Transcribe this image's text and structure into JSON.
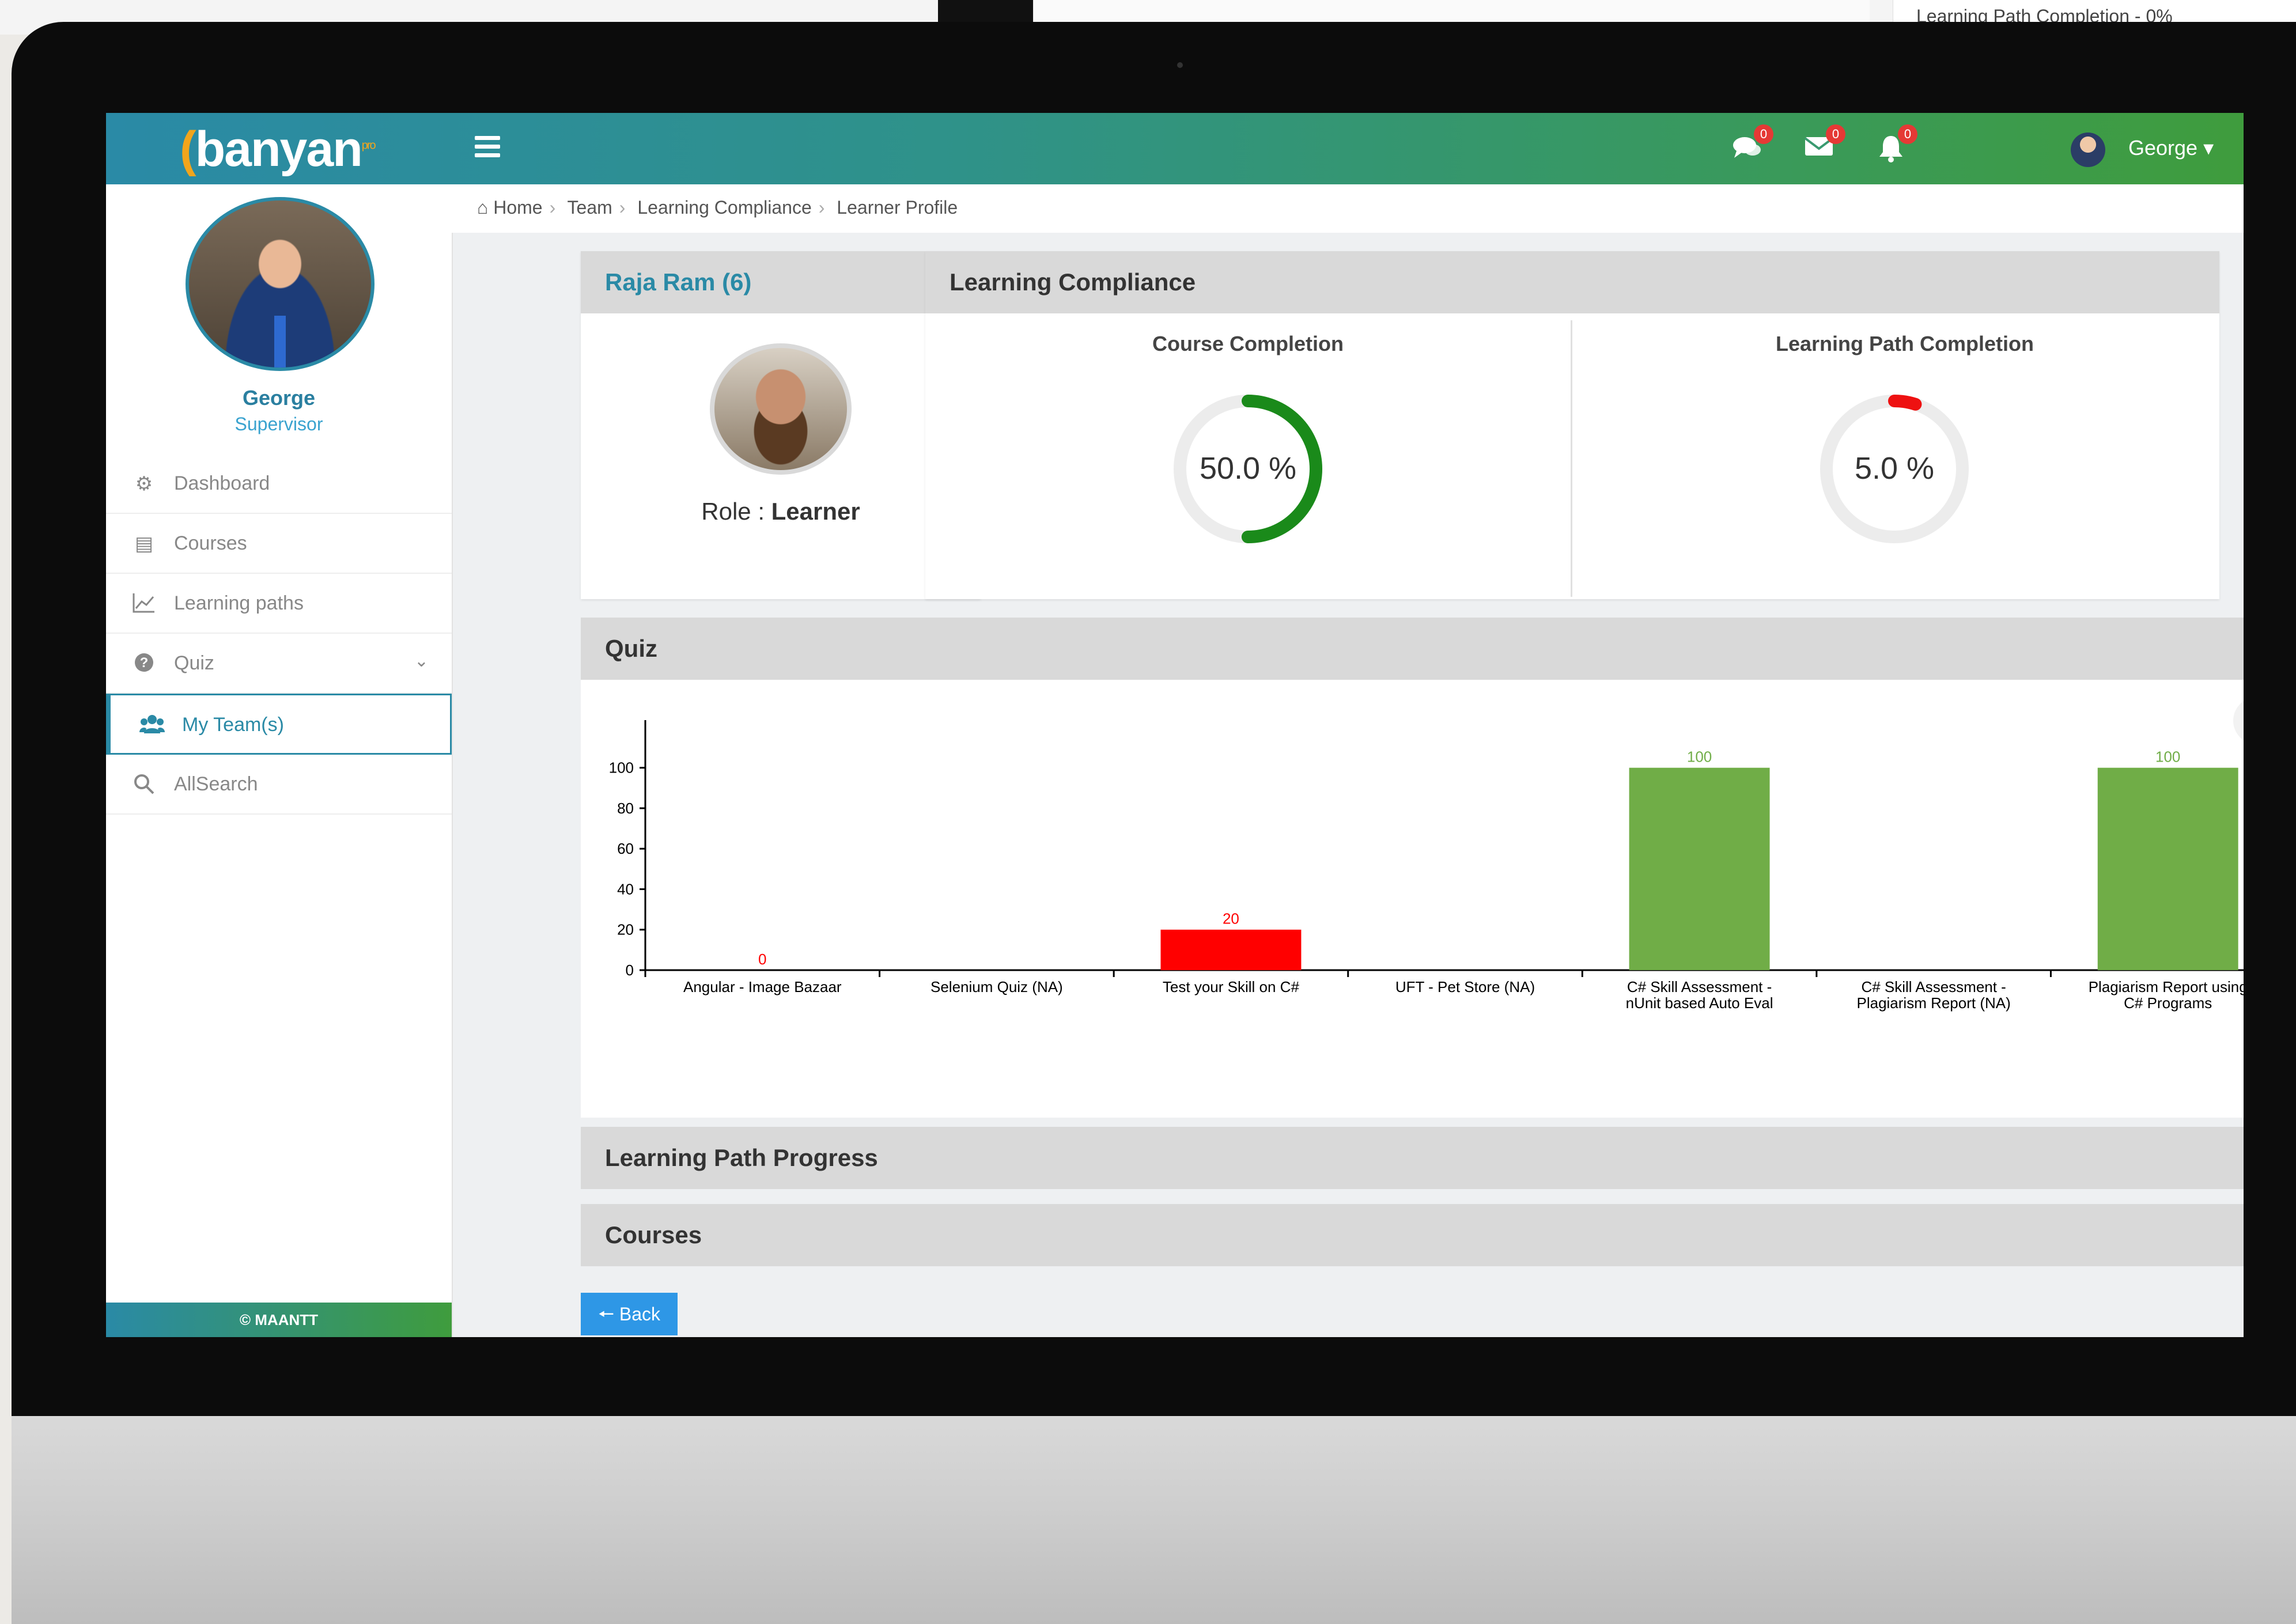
{
  "top_strip": {
    "learning_path_completion_label": "Learning Path Completion - 0%"
  },
  "header": {
    "logo_text": "banyan",
    "logo_superscript": "pro",
    "badges": {
      "chat": "0",
      "mail": "0",
      "alerts": "0"
    },
    "user_name": "George ▾"
  },
  "sidebar": {
    "profile": {
      "name": "George",
      "role": "Supervisor"
    },
    "items": [
      {
        "label": "Dashboard",
        "icon": "dashboard-icon"
      },
      {
        "label": "Courses",
        "icon": "book-icon"
      },
      {
        "label": "Learning paths",
        "icon": "line-chart-icon"
      },
      {
        "label": "Quiz",
        "icon": "question-circle-icon"
      },
      {
        "label": "My Team(s)",
        "icon": "users-icon"
      },
      {
        "label": "AllSearch",
        "icon": "search-icon"
      }
    ],
    "footer": "© MAANTT"
  },
  "breadcrumb": [
    "Home",
    "Team",
    "Learning Compliance",
    "Learner Profile"
  ],
  "learner_card": {
    "title": "Raja Ram (6)",
    "role_label": "Role :",
    "role_value": "Learner"
  },
  "compliance": {
    "title": "Learning Compliance",
    "course_completion": {
      "label": "Course Completion",
      "value_text": "50.0 %",
      "fraction": 0.5,
      "color": "#1a8a1a"
    },
    "learning_path_completion": {
      "label": "Learning Path Completion",
      "value_text": "5.0 %",
      "fraction": 0.05,
      "color": "#ee1111"
    }
  },
  "sections": {
    "quiz": "Quiz",
    "learning_path_progress": "Learning Path Progress",
    "courses": "Courses"
  },
  "back_button": "Back",
  "colors": {
    "good": "#70ad47",
    "bad": "#ff0000"
  },
  "chart_data": {
    "type": "bar",
    "categories": [
      [
        "Angular - Image Bazaar"
      ],
      [
        "Selenium Quiz (NA)"
      ],
      [
        "Test your Skill on C#"
      ],
      [
        "UFT - Pet Store (NA)"
      ],
      [
        "C# Skill Assessment -",
        "nUnit based Auto Eval"
      ],
      [
        "C# Skill Assessment -",
        "Plagiarism Report (NA)"
      ],
      [
        "Plagiarism Report using",
        "C# Programs"
      ]
    ],
    "values": [
      0,
      null,
      20,
      null,
      100,
      null,
      100
    ],
    "value_labels": [
      "0",
      "",
      "20",
      "",
      "100",
      "",
      "100"
    ],
    "bar_colors": [
      "#ff0000",
      null,
      "#ff0000",
      null,
      "#70ad47",
      null,
      "#70ad47"
    ],
    "yticks": [
      "0",
      "20",
      "40",
      "60",
      "80",
      "100"
    ],
    "ylim": [
      0,
      115
    ],
    "grid": false
  }
}
